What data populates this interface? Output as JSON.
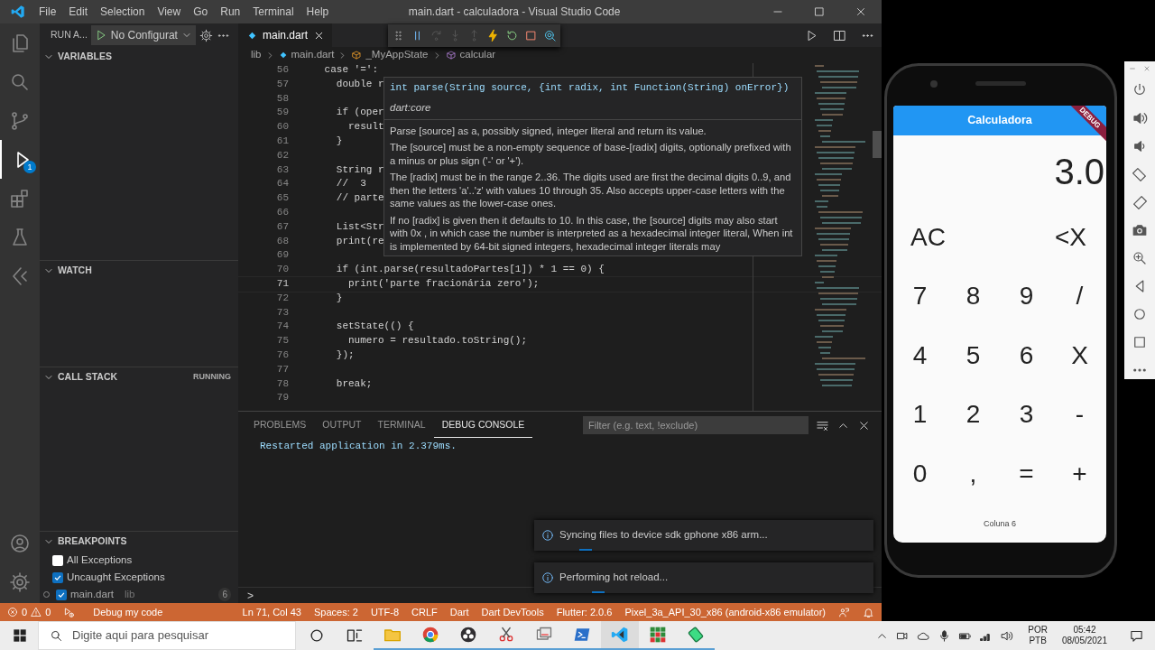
{
  "window": {
    "title": "main.dart - calculadora - Visual Studio Code"
  },
  "menu": [
    "File",
    "Edit",
    "Selection",
    "View",
    "Go",
    "Run",
    "Terminal",
    "Help"
  ],
  "activity_bar": {
    "debug_badge": "1"
  },
  "run_panel": {
    "title": "RUN A...",
    "configuration": "No Configurat"
  },
  "sidebar_sections": [
    {
      "title": "VARIABLES",
      "expanded": true
    },
    {
      "title": "WATCH",
      "expanded": true
    },
    {
      "title": "CALL STACK",
      "expanded": true,
      "status": "RUNNING"
    },
    {
      "title": "BREAKPOINTS",
      "expanded": true
    }
  ],
  "breakpoints": [
    {
      "label": "All Exceptions",
      "checked": false
    },
    {
      "label": "Uncaught Exceptions",
      "checked": true
    },
    {
      "label": "main.dart",
      "detail": "lib",
      "count": "6",
      "checked": true
    }
  ],
  "editor_tab": {
    "label": "main.dart"
  },
  "breadcrumbs": [
    "lib",
    "main.dart",
    "_MyAppState",
    "calcular"
  ],
  "code_lines": [
    {
      "number": "56",
      "text": "      case '=':",
      "current": false
    },
    {
      "number": "57",
      "text": "        double r",
      "current": false
    },
    {
      "number": "58",
      "current": false
    },
    {
      "number": "59",
      "text": "        if (oper",
      "current": false
    },
    {
      "number": "60",
      "text": "          result",
      "current": false
    },
    {
      "number": "61",
      "text": "        }",
      "current": false
    },
    {
      "number": "62",
      "current": false
    },
    {
      "number": "63",
      "text": "        String r",
      "current": false
    },
    {
      "number": "64",
      "text": "        //  3",
      "current": false
    },
    {
      "number": "65",
      "text": "        // parte",
      "current": false
    },
    {
      "number": "66",
      "current": false
    },
    {
      "number": "67",
      "text": "        List<Str",
      "current": false
    },
    {
      "number": "68",
      "text": "        print(re",
      "current": false
    },
    {
      "number": "69",
      "current": false
    },
    {
      "number": "70",
      "text": "        if (int.parse(resultadoPartes[1]) * 1 == 0) {",
      "current": false
    },
    {
      "number": "71",
      "text": "          print('parte fracionária zero');",
      "current": true
    },
    {
      "number": "72",
      "text": "        }",
      "current": false
    },
    {
      "number": "73",
      "current": false
    },
    {
      "number": "74",
      "text": "        setState(() {",
      "current": false
    },
    {
      "number": "75",
      "text": "          numero = resultado.toString();",
      "current": false
    },
    {
      "number": "76",
      "text": "        });",
      "current": false
    },
    {
      "number": "77",
      "current": false
    },
    {
      "number": "78",
      "text": "        break;",
      "current": false
    },
    {
      "number": "79",
      "current": false
    }
  ],
  "hover": {
    "signature": "int parse(String source, {int radix, int Function(String) onError})",
    "library": "dart:core",
    "paragraphs": [
      "Parse [source] as a, possibly signed, integer literal and return its value.",
      "The [source] must be a non-empty sequence of base-[radix] digits, optionally prefixed with a minus or plus sign ('-' or '+').",
      "The [radix] must be in the range 2..36. The digits used are first the decimal digits 0..9, and then the letters 'a'..'z' with values 10 through 35. Also accepts upper-case letters with the same values as the lower-case ones.",
      "If no [radix] is given then it defaults to 10. In this case, the [source] digits may also start with 0x , in which case the number is interpreted as a hexadecimal integer literal, When int is implemented by 64-bit signed integers, hexadecimal integer literals may"
    ]
  },
  "panel": {
    "tabs": [
      {
        "label": "PROBLEMS",
        "selected": false
      },
      {
        "label": "OUTPUT",
        "selected": false
      },
      {
        "label": "TERMINAL",
        "selected": false
      },
      {
        "label": "DEBUG CONSOLE",
        "selected": true
      }
    ],
    "filter_placeholder": "Filter (e.g. text, !exclude)",
    "output": [
      "Restarted application in 2.379ms."
    ],
    "prompt": ">"
  },
  "notifications": [
    "Syncing files to device sdk gphone x86 arm...",
    "Performing hot reload..."
  ],
  "status_bar": {
    "errors": "0",
    "warnings": "0",
    "debug_label": "Debug my code",
    "items": [
      "Ln 71, Col 43",
      "Spaces: 2",
      "UTF-8",
      "CRLF",
      "Dart",
      "Dart DevTools",
      "Flutter: 2.0.6",
      "Pixel_3a_API_30_x86 (android-x86 emulator)"
    ]
  },
  "emulator": {
    "app_title": "Calculadora",
    "banner": "DEBUG",
    "display": "3.0",
    "keypad": [
      [
        "AC",
        "<X"
      ],
      [
        "7",
        "8",
        "9",
        "/"
      ],
      [
        "4",
        "5",
        "6",
        "X"
      ],
      [
        "1",
        "2",
        "3",
        "-"
      ],
      [
        "0",
        ",",
        "=",
        "+"
      ]
    ],
    "footer": "Coluna 6"
  },
  "taskbar": {
    "search_placeholder": "Digite aqui para pesquisar",
    "language": "POR",
    "layout": "PTB",
    "time": "05:42",
    "date": "08/05/2021"
  }
}
